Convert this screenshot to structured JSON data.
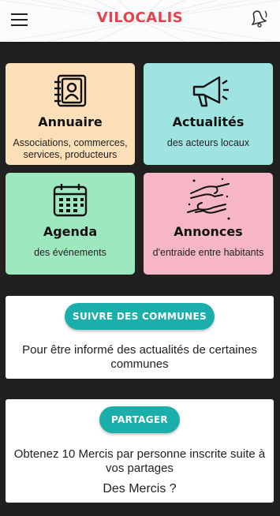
{
  "header": {
    "brand": "VILOCALIS",
    "menu_icon": "hamburger-menu-icon",
    "notification_icon": "bell-icon"
  },
  "tiles": [
    {
      "title": "Annuaire",
      "subtitle": "Associations, commerces, services, producteurs",
      "icon": "address-book-icon",
      "color": "#fde0b9"
    },
    {
      "title": "Actualités",
      "subtitle": "des acteurs locaux",
      "icon": "megaphone-icon",
      "color": "#9fe4e1"
    },
    {
      "title": "Agenda",
      "subtitle": "des événements",
      "icon": "calendar-icon",
      "color": "#9ee8c0"
    },
    {
      "title": "Annonces",
      "subtitle": "d'entraide entre habitants",
      "icon": "helping-hands-icon",
      "color": "#f7b6c6"
    }
  ],
  "follow": {
    "button_label": "SUIVRE DES COMMUNES",
    "text": "Pour être informé des actualités de certaines communes"
  },
  "share": {
    "button_label": "PARTAGER",
    "text": "Obtenez 10 Mercis par personne inscrite suite à vos partages",
    "link": "Des Mercis ?"
  },
  "colors": {
    "brand": "#e2434f",
    "accent": "#1aafaa",
    "background": "#202020"
  }
}
